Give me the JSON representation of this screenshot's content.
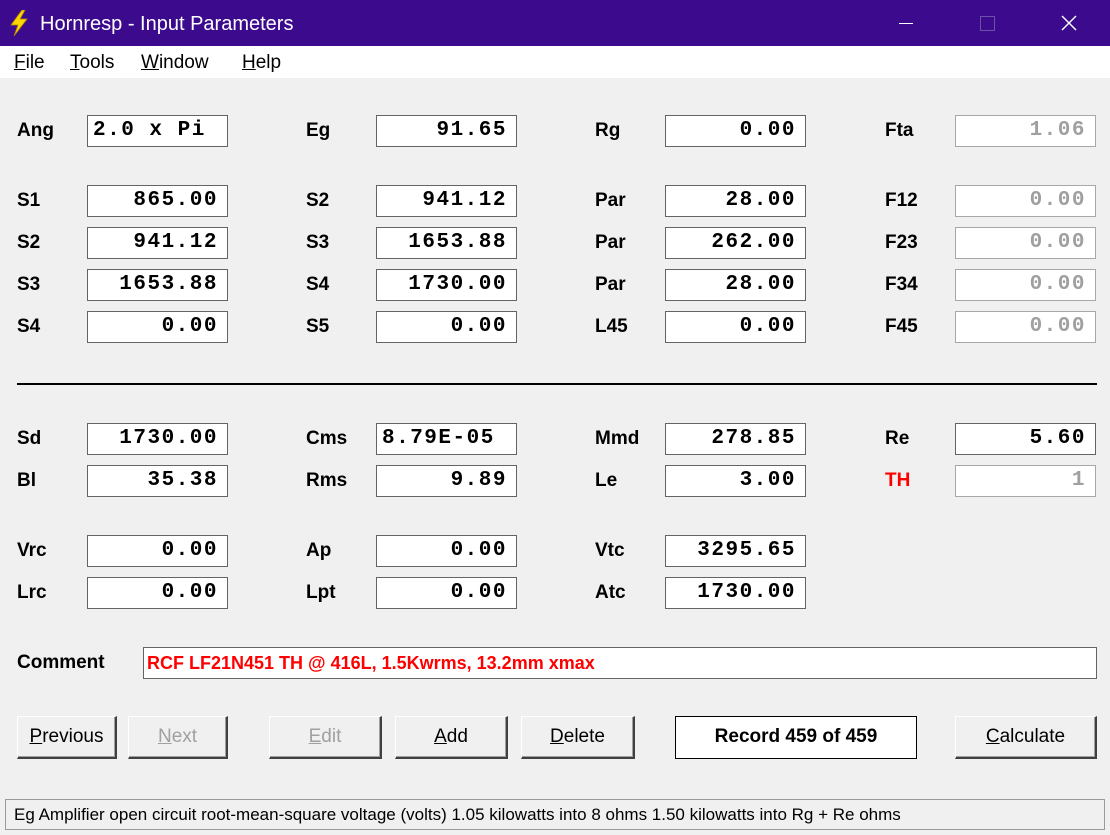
{
  "window": {
    "title": "Hornresp - Input Parameters",
    "menu": [
      {
        "label": "File",
        "key": "F"
      },
      {
        "label": "Tools",
        "key": "T"
      },
      {
        "label": "Window",
        "key": "W"
      },
      {
        "label": "Help",
        "key": "H"
      }
    ],
    "controls": {
      "minimize": "minimize-icon",
      "maximize": "maximize-icon",
      "close": "close-icon"
    }
  },
  "params": {
    "ang": {
      "label": "Ang",
      "value": "2.0 x Pi"
    },
    "eg": {
      "label": "Eg",
      "value": "91.65"
    },
    "rg": {
      "label": "Rg",
      "value": "0.00"
    },
    "fta": {
      "label": "Fta",
      "value": "1.06"
    },
    "s1": {
      "label": "S1",
      "value": "865.00"
    },
    "s2a": {
      "label": "S2",
      "value": "941.12"
    },
    "par1": {
      "label": "Par",
      "value": "28.00"
    },
    "f12": {
      "label": "F12",
      "value": "0.00"
    },
    "s2": {
      "label": "S2",
      "value": "941.12"
    },
    "s3a": {
      "label": "S3",
      "value": "1653.88"
    },
    "par2": {
      "label": "Par",
      "value": "262.00"
    },
    "f23": {
      "label": "F23",
      "value": "0.00"
    },
    "s3": {
      "label": "S3",
      "value": "1653.88"
    },
    "s4a": {
      "label": "S4",
      "value": "1730.00"
    },
    "par3": {
      "label": "Par",
      "value": "28.00"
    },
    "f34": {
      "label": "F34",
      "value": "0.00"
    },
    "s4": {
      "label": "S4",
      "value": "0.00"
    },
    "s5": {
      "label": "S5",
      "value": "0.00"
    },
    "l45": {
      "label": "L45",
      "value": "0.00"
    },
    "f45": {
      "label": "F45",
      "value": "0.00"
    },
    "sd": {
      "label": "Sd",
      "value": "1730.00"
    },
    "cms": {
      "label": "Cms",
      "value": "8.79E-05"
    },
    "mmd": {
      "label": "Mmd",
      "value": "278.85"
    },
    "re": {
      "label": "Re",
      "value": "5.60"
    },
    "bl": {
      "label": "Bl",
      "value": "35.38"
    },
    "rms": {
      "label": "Rms",
      "value": "9.89"
    },
    "le": {
      "label": "Le",
      "value": "3.00"
    },
    "th": {
      "label": "TH",
      "value": "1"
    },
    "vrc": {
      "label": "Vrc",
      "value": "0.00"
    },
    "ap": {
      "label": "Ap",
      "value": "0.00"
    },
    "vtc": {
      "label": "Vtc",
      "value": "3295.65"
    },
    "lrc": {
      "label": "Lrc",
      "value": "0.00"
    },
    "lpt": {
      "label": "Lpt",
      "value": "0.00"
    },
    "atc": {
      "label": "Atc",
      "value": "1730.00"
    }
  },
  "comment": {
    "label": "Comment",
    "value": "RCF LF21N451 TH @ 416L, 1.5Kwrms, 13.2mm xmax"
  },
  "buttons": {
    "previous": {
      "label": "Previous",
      "key": "P",
      "rest": "revious",
      "enabled": true
    },
    "next": {
      "label": "Next",
      "key": "N",
      "rest": "ext",
      "enabled": false
    },
    "edit": {
      "label": "Edit",
      "key": "E",
      "rest": "dit",
      "enabled": false
    },
    "add": {
      "label": "Add",
      "key": "A",
      "rest": "dd",
      "enabled": true
    },
    "delete": {
      "label": "Delete",
      "key": "D",
      "rest": "elete",
      "enabled": true
    },
    "calculate": {
      "label": "Calculate",
      "key": "C",
      "rest": "alculate",
      "enabled": true
    }
  },
  "record": "Record 459 of 459",
  "status": "Eg  Amplifier open circuit root-mean-square voltage  (volts)   1.05 kilowatts into 8 ohms   1.50 kilowatts into Rg + Re ohms",
  "colors": {
    "titlebar": "#3c0a8c",
    "accent_red": "#ff0000",
    "disabled": "#a0a0a0"
  }
}
